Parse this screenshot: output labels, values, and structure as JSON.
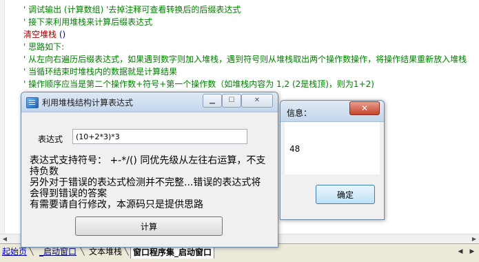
{
  "editor": {
    "lines": [
      {
        "text": "' 调试输出 (计算数组) '去掉注释可查看转换后的后缀表达式",
        "kind": "comment"
      },
      {
        "text": "' 接下来利用堆栈来计算后缀表达式",
        "kind": "comment"
      },
      {
        "text": "清空堆栈",
        "kind": "stmt",
        "suffix": " ()"
      },
      {
        "text": "' 思路如下:",
        "kind": "comment"
      },
      {
        "text": "' 从左向右遍历后缀表达式，如果遇到数字则加入堆栈，遇到符号则从堆栈取出两个操作数操作，将操作结果重新放入堆栈",
        "kind": "comment"
      },
      {
        "text": "' 当循环结束时堆栈内的数据就是计算结果",
        "kind": "comment"
      },
      {
        "text": "' 操作顺序应当是第二个操作数+符号+第一个操作数（如堆栈内容为 1,2 (2是栈顶)，则为1+2)",
        "kind": "comment"
      }
    ]
  },
  "tabs": {
    "items": [
      {
        "label": "起始页",
        "style": "start"
      },
      {
        "label": "_启动窗口",
        "style": "window"
      },
      {
        "label": "文本堆栈",
        "style": "normal"
      },
      {
        "label": "窗口程序集_启动窗口",
        "style": "active"
      }
    ]
  },
  "dialog": {
    "title": "利用堆栈结构计算表达式",
    "expr_label": "表达式",
    "expr_value": "(10+2*3)*3",
    "info_lines": [
      "表达式支持符号：  +-*/() 同优先级从左往右运算，不支持负数",
      "另外对于错误的表达式检测并不完整...错误的表达式将会得到错误的答案",
      "有需要请自行修改，本源码只是提供思路"
    ],
    "calc_button": "计算"
  },
  "msgbox": {
    "title": "信息：",
    "message": "48",
    "ok_button": "确定"
  }
}
